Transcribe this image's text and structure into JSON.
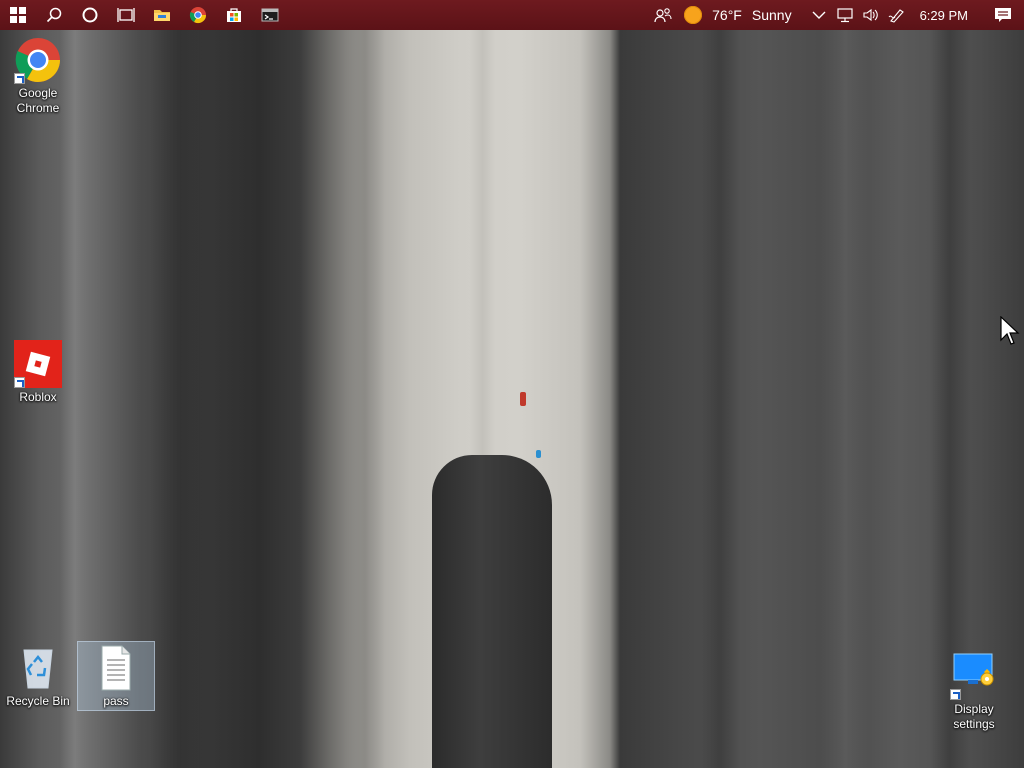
{
  "taskbar": {
    "apps": [
      {
        "name": "start-button",
        "icon": "windows-logo-icon"
      },
      {
        "name": "search-button",
        "icon": "search-icon"
      },
      {
        "name": "cortana-button",
        "icon": "circle-icon"
      },
      {
        "name": "task-view-button",
        "icon": "task-view-icon"
      },
      {
        "name": "file-explorer-button",
        "icon": "folder-icon"
      },
      {
        "name": "chrome-button",
        "icon": "chrome-icon"
      },
      {
        "name": "store-button",
        "icon": "store-icon"
      },
      {
        "name": "terminal-button",
        "icon": "terminal-icon"
      }
    ],
    "tray": {
      "weather_temp": "76°F",
      "weather_condition": "Sunny",
      "time": "6:29 PM"
    },
    "color": "#6a171c"
  },
  "desktop": {
    "icons": {
      "chrome": "Google Chrome",
      "roblox": "Roblox",
      "recycle_bin": "Recycle Bin",
      "pass": "pass",
      "display_settings": "Display settings"
    }
  }
}
